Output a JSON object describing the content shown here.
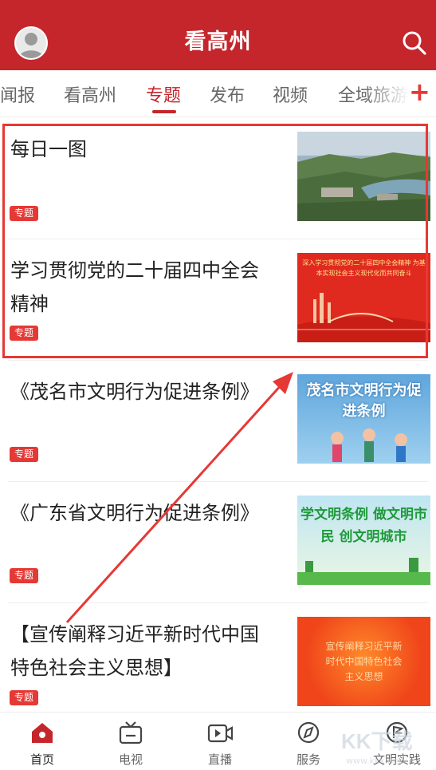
{
  "header": {
    "title": "看高州",
    "accent": "#c4262c"
  },
  "tabs": [
    {
      "label": "闻报"
    },
    {
      "label": "看高州"
    },
    {
      "label": "专题",
      "active": true
    },
    {
      "label": "发布"
    },
    {
      "label": "视频"
    },
    {
      "label": "全域旅游"
    }
  ],
  "tab_add_label": "+",
  "items": [
    {
      "title": "每日一图",
      "tag": "专题",
      "thumb_text": ""
    },
    {
      "title": "学习贯彻党的二十届四中全会精神",
      "tag": "专题",
      "thumb_text": "深入学习贯彻党的二十届四中全会精神 为基本实现社会主义现代化而共同奋斗"
    },
    {
      "title": "《茂名市文明行为促进条例》",
      "tag": "专题",
      "thumb_text": "茂名市文明行为促进条例"
    },
    {
      "title": "《广东省文明行为促进条例》",
      "tag": "专题",
      "thumb_text": "学文明条例 做文明市民 创文明城市"
    },
    {
      "title": "【宣传阐释习近平新时代中国特色社会主义思想】",
      "tag": "专题",
      "thumb_text": "宣传阐释习近平新时代中国特色社会主义思想"
    }
  ],
  "bottom_nav": [
    {
      "label": "首页",
      "icon": "home-icon",
      "active": true
    },
    {
      "label": "电视",
      "icon": "tv-icon"
    },
    {
      "label": "直播",
      "icon": "live-video-icon"
    },
    {
      "label": "服务",
      "icon": "compass-icon"
    },
    {
      "label": "文明实践",
      "icon": "flag-icon"
    }
  ],
  "watermark": {
    "text": "KK下载",
    "sub": "www.kkx.net"
  }
}
